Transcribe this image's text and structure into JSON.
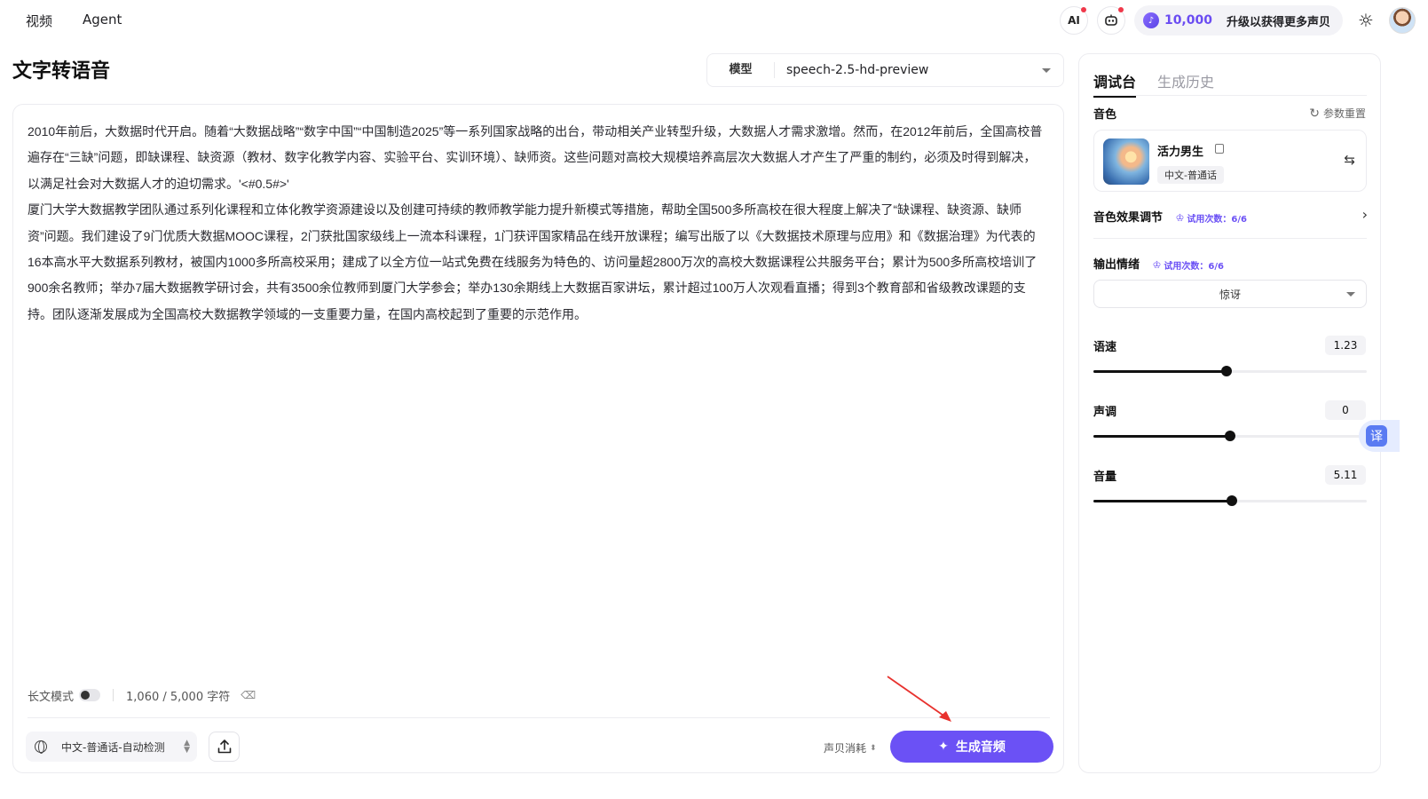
{
  "nav": {
    "links": [
      "视频",
      "Agent"
    ],
    "ai_label": "AI",
    "credits": "10,000",
    "upgrade": "升级以获得更多声贝"
  },
  "page": {
    "title": "文字转语音"
  },
  "model": {
    "label": "模型",
    "value": "speech-2.5-hd-preview"
  },
  "editor": {
    "text": "2010年前后，大数据时代开启。随着“大数据战略”“数字中国”“中国制造2025”等一系列国家战略的出台，带动相关产业转型升级，大数据人才需求激增。然而，在2012年前后，全国高校普遍存在“三缺”问题，即缺课程、缺资源（教材、数字化教学内容、实验平台、实训环境）、缺师资。这些问题对高校大规模培养高层次大数据人才产生了严重的制约，必须及时得到解决，以满足社会对大数据人才的迫切需求。'<#0.5#>'\n厦门大学大数据教学团队通过系列化课程和立体化教学资源建设以及创建可持续的教师教学能力提升新模式等措施，帮助全国500多所高校在很大程度上解决了“缺课程、缺资源、缺师资”问题。我们建设了9门优质大数据MOOC课程，2门获批国家级线上一流本科课程，1门获评国家精品在线开放课程；编写出版了以《大数据技术原理与应用》和《数据治理》为代表的16本高水平大数据系列教材，被国内1000多所高校采用；建成了以全方位一站式免费在线服务为特色的、访问量超2800万次的高校大数据课程公共服务平台；累计为500多所高校培训了900余名教师；举办7届大数据教学研讨会，共有3500余位教师到厦门大学参会；举办130余期线上大数据百家讲坛，累计超过100万人次观看直播；得到3个教育部和省级教改课题的支持。团队逐渐发展成为全国高校大数据教学领域的一支重要力量，在国内高校起到了重要的示范作用。",
    "long_mode_label": "长文模式",
    "char_count": "1,060 / 5,000 字符",
    "language": "中文-普通话-自动检测",
    "cost_label": "声贝消耗",
    "generate_label": "生成音频"
  },
  "panel": {
    "tabs": [
      "调试台",
      "生成历史"
    ],
    "voice_title": "音色",
    "reset_label": "参数重置",
    "voice_name": "活力男生",
    "voice_tag": "中文-普通话",
    "effect_title": "音色效果调节",
    "trial_label": "试用次数：6/6",
    "emotion_title": "输出情绪",
    "emotion_value": "惊讶",
    "sliders": [
      {
        "label": "语速",
        "value": "1.23",
        "fraction": 0.487
      },
      {
        "label": "声调",
        "value": "0",
        "fraction": 0.5
      },
      {
        "label": "音量",
        "value": "5.11",
        "fraction": 0.508
      }
    ]
  },
  "float": {
    "translate": "译"
  },
  "colors": {
    "accent": "#6b51f5",
    "annotation": "#e8322e"
  }
}
